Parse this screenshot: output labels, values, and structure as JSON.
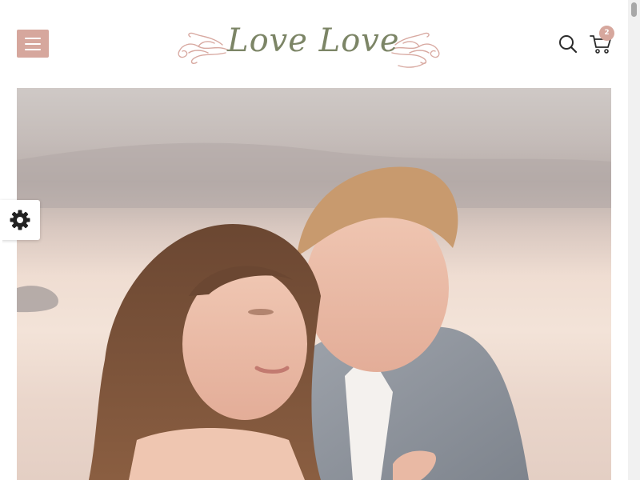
{
  "header": {
    "logo_text": "Love Love",
    "menu_icon": "hamburger-icon",
    "search_icon": "search-icon",
    "cart_icon": "cart-icon",
    "cart_count": "2"
  },
  "hero": {
    "image": "wedding-couple-photo"
  },
  "settings": {
    "icon": "gear-icon"
  },
  "colors": {
    "accent": "#d6a79d",
    "logo_green": "#7c8566",
    "logo_flourish": "#d8a9a1",
    "icon_dark": "#2b2b2b"
  }
}
